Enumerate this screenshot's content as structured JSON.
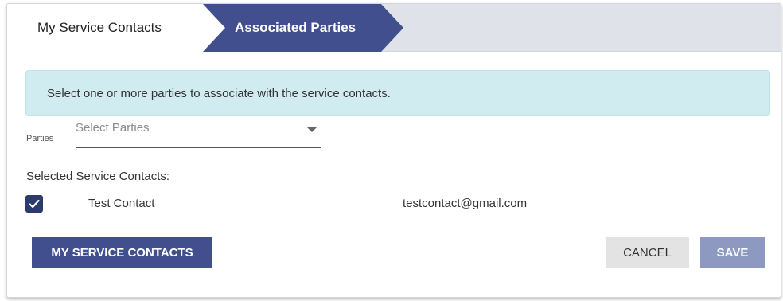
{
  "stepper": {
    "steps": [
      {
        "label": "My Service Contacts",
        "state": "completed"
      },
      {
        "label": "Associated Parties",
        "state": "active"
      }
    ]
  },
  "alert": {
    "message": "Select one or more parties to associate with the service contacts."
  },
  "parties": {
    "label": "Parties",
    "placeholder": "Select Parties",
    "value": ""
  },
  "selected_contacts": {
    "heading": "Selected Service Contacts:",
    "rows": [
      {
        "checked": true,
        "name": "Test Contact",
        "email": "testcontact@gmail.com"
      }
    ]
  },
  "actions": {
    "my_service_contacts_label": "MY SERVICE CONTACTS",
    "cancel_label": "CANCEL",
    "save_label": "SAVE"
  },
  "colors": {
    "primary": "#414f8e",
    "primary_disabled": "#8d99c1",
    "alert_bg": "#d1ecf1",
    "checkbox": "#2d3a6e"
  }
}
